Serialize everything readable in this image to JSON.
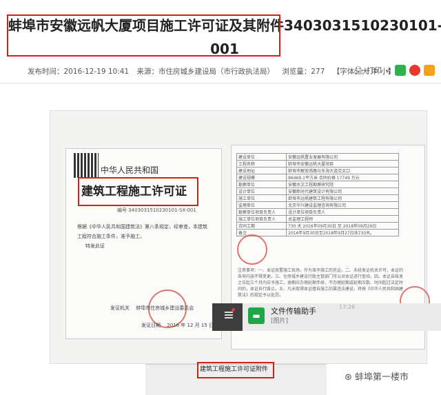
{
  "article": {
    "title_line1": "蚌埠市安徽远帆大厦项目施工许可证及其附件3403031510230101-S",
    "title_line2": "001"
  },
  "meta": {
    "publish_time": "发布时间：2016-12-19 10:41",
    "source": "来源：市住房城乡建设局（市行政执法局）",
    "views": "浏览量：277",
    "font_size": "【字体：大 中 小】",
    "print_label": "打印"
  },
  "share": {
    "print_icon": "printer-icon",
    "share_icon": "share-icon",
    "wechat_icon": "wechat-icon",
    "weibo_icon": "weibo-icon",
    "fav_icon": "star-icon",
    "colors": {
      "wechat": "#2fb24a",
      "weibo": "#e5372c",
      "fav": "#f7a11a"
    }
  },
  "doc_left": {
    "header": "中华人民共和国",
    "title": "建筑工程施工许可证",
    "number": "编号 3403031510230101-SX-001",
    "body": "根据《中华人民共和国建筑法》第八条规定，经审查，本建筑工程符合施工条件，准予施工。",
    "special": "特发此证",
    "issuer": "发证机关",
    "issuer_name": "蚌埠市住房城乡建设委员会",
    "date_label": "发证日期",
    "date": "2016 年 12 月 15 日"
  },
  "doc_right": {
    "rows": [
      [
        "建设单位",
        "安徽远帆置业发展有限公司"
      ],
      [
        "工程名称",
        "蚌埠市安徽远帆大厦项目"
      ],
      [
        "建设地址",
        "蚌埠市解放南路与东海大道交叉口"
      ],
      [
        "建设规模",
        "86469.1平方米 合同价格 17749 万元"
      ],
      [
        "勘察单位",
        "安徽水文工程勘察研究院"
      ],
      [
        "设计单位",
        "安徽新时代建筑设计有限公司"
      ],
      [
        "施工单位",
        "蚌埠市远帆建筑工程有限公司"
      ],
      [
        "监理单位",
        "北京华兴建设监理咨询有限公司"
      ],
      [
        "勘察单位项目负责人",
        "设计单位项目负责人"
      ],
      [
        "施工单位项目负责人",
        "总监理工程师"
      ],
      [
        "合同工期",
        "730 天 2016年09月30日 至 2018年09月29日"
      ],
      [
        "备注",
        "2016年9月30日至2018年9月27日共730天。"
      ]
    ],
    "notes": "注意事项：一、本证放置施工现场，作为准予施工的凭证。二、未经发证机关许可，本证的各项内容不得变更。三、住房城乡建设行政主管部门可以对本证进行查验。四、本证自核发之日起三个月内应予施工，逾期应办理延期手续，不办理延期或延期次数、时间超过法定时间的，本证自行废止。五、凡未取得本证擅自施工的属违法建设，将按《中华人民共和国建筑法》的规定予以处罚。"
  },
  "second_doc": {
    "title": "建筑工程施工许可证附件"
  },
  "overlay": {
    "app_name": "文件传输助手",
    "subtitle": "[图片]",
    "time": "17:26"
  },
  "watermark": {
    "text": "蚌埠第一楼市",
    "icon": "wechat-official-icon"
  }
}
